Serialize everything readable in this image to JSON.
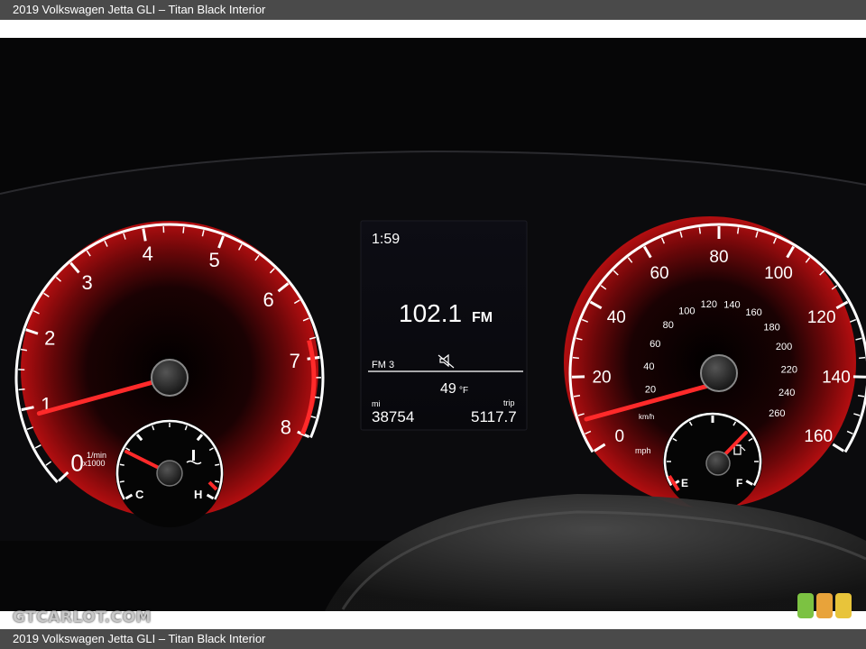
{
  "caption": {
    "text": "2019 Volkswagen Jetta GLI – Titan Black Interior"
  },
  "tachometer": {
    "labels": [
      "0",
      "1",
      "2",
      "3",
      "4",
      "5",
      "6",
      "7",
      "8"
    ],
    "unit_line1": "1/min",
    "unit_line2": "x1000",
    "reading": 0.9
  },
  "temp_gauge": {
    "low_label": "C",
    "high_label": "H"
  },
  "display": {
    "clock": "1:59",
    "frequency": "102.1",
    "band": "FM",
    "preset": "FM 3",
    "outside_temp": "49",
    "temp_unit": "°F",
    "odo_unit": "mi",
    "odometer": "38754",
    "trip_label": "trip",
    "trip": "5117.7"
  },
  "speedometer": {
    "mph_labels": [
      "0",
      "20",
      "40",
      "60",
      "80",
      "100",
      "120",
      "140",
      "160"
    ],
    "kmh_labels": [
      "20",
      "40",
      "60",
      "80",
      "100",
      "120",
      "140",
      "160",
      "180",
      "200",
      "220",
      "240",
      "260"
    ],
    "mph_unit": "mph",
    "kmh_unit": "km/h",
    "reading": 0
  },
  "fuel_gauge": {
    "empty_label": "E",
    "full_label": "F"
  },
  "watermark": {
    "text": "GTCARLOT.COM"
  },
  "colors": {
    "accent_red": "#ff2a2a",
    "dial_white": "#ffffff",
    "badge_green": "#7cc242",
    "badge_orange": "#e8a33a",
    "badge_yellow": "#e8c43a"
  }
}
